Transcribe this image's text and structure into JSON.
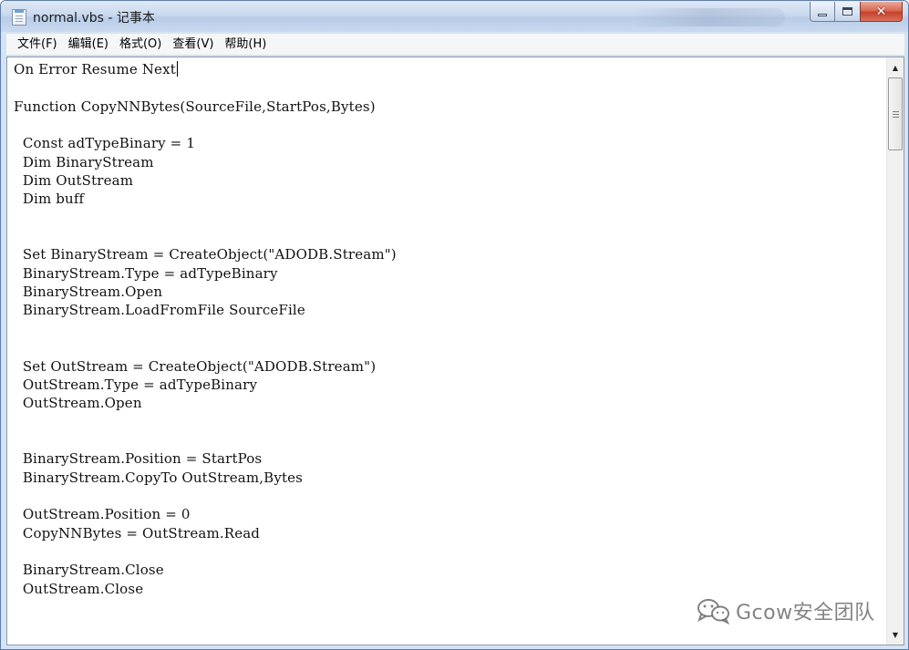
{
  "window": {
    "title": "normal.vbs - 记事本"
  },
  "menu": {
    "items": [
      "文件(F)",
      "编辑(E)",
      "格式(O)",
      "查看(V)",
      "帮助(H)"
    ]
  },
  "editor": {
    "lines": [
      "On Error Resume Next",
      "",
      "Function CopyNNBytes(SourceFile,StartPos,Bytes)",
      "",
      "  Const adTypeBinary = 1",
      "  Dim BinaryStream",
      "  Dim OutStream",
      "  Dim buff",
      "",
      "",
      "  Set BinaryStream = CreateObject(\"ADODB.Stream\")",
      "  BinaryStream.Type = adTypeBinary",
      "  BinaryStream.Open",
      "  BinaryStream.LoadFromFile SourceFile",
      "",
      "",
      "  Set OutStream = CreateObject(\"ADODB.Stream\")",
      "  OutStream.Type = adTypeBinary",
      "  OutStream.Open",
      "",
      "",
      "  BinaryStream.Position = StartPos",
      "  BinaryStream.CopyTo OutStream,Bytes",
      "",
      "  OutStream.Position = 0",
      "  CopyNNBytes = OutStream.Read",
      "",
      "  BinaryStream.Close",
      "  OutStream.Close"
    ]
  },
  "watermark": {
    "text": "Gcow安全团队"
  },
  "icons": {
    "app": "notepad-icon",
    "minimize": "minimize-icon",
    "maximize": "maximize-icon",
    "close": "close-icon",
    "scroll_up": "scroll-up-arrow-icon",
    "scroll_down": "scroll-down-arrow-icon",
    "watermark": "wechat-logo"
  },
  "colors": {
    "close_button": "#c7412a",
    "titlebar": "#c9d9ee"
  }
}
